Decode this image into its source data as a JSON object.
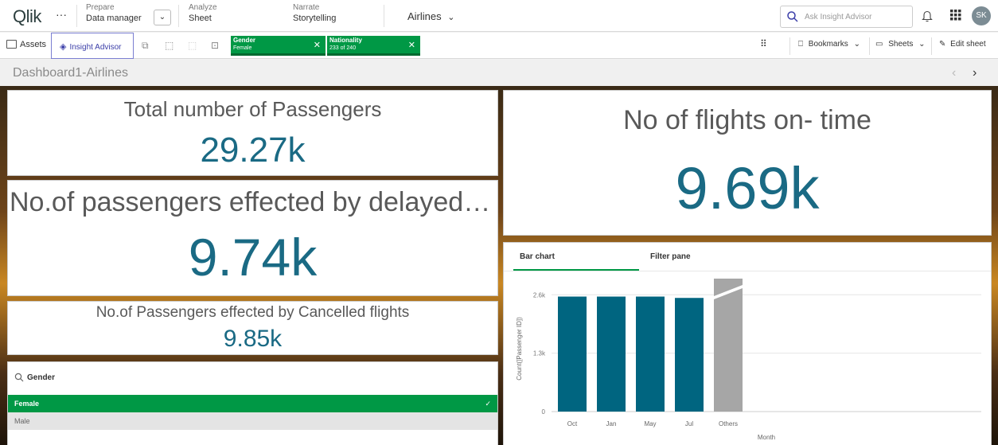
{
  "app": {
    "logo": "Qlik",
    "more": "···",
    "nav": [
      {
        "small": "Prepare",
        "big": "Data manager"
      },
      {
        "small": "Analyze",
        "big": "Sheet"
      },
      {
        "small": "Narrate",
        "big": "Storytelling"
      }
    ],
    "app_name": "Airlines",
    "search_placeholder": "Ask Insight Advisor",
    "avatar": "SK"
  },
  "toolbar": {
    "assets": "Assets",
    "insight_advisor": "Insight Advisor",
    "selections": [
      {
        "field": "Gender",
        "value": "Female"
      },
      {
        "field": "Nationality",
        "value": "233 of 240"
      }
    ],
    "bookmarks": "Bookmarks",
    "sheets": "Sheets",
    "edit_sheet": "Edit sheet"
  },
  "sheet": {
    "title": "Dashboard1-Airlines"
  },
  "kpis": {
    "total_passengers": {
      "title": "Total number of Passengers",
      "value": "29.27k"
    },
    "delayed": {
      "title": "No.of passengers effected by delayed fli...",
      "value": "9.74k"
    },
    "cancelled": {
      "title": "No.of Passengers effected by Cancelled flights",
      "value": "9.85k"
    },
    "on_time": {
      "title": "No of flights on- time",
      "value": "9.69k"
    }
  },
  "filter_pane": {
    "field": "Gender",
    "items": [
      {
        "label": "Female",
        "state": "selected"
      },
      {
        "label": "Male",
        "state": "alternative"
      }
    ]
  },
  "chart_tabs": [
    "Bar chart",
    "Filter pane"
  ],
  "chart_data": {
    "type": "bar",
    "categories": [
      "Oct",
      "Jan",
      "May",
      "Jul",
      "Others"
    ],
    "values": [
      2560,
      2560,
      2560,
      2530,
      2960
    ],
    "ylim": [
      0,
      2800
    ],
    "yticks": [
      {
        "value": 0,
        "label": "0"
      },
      {
        "value": 1300,
        "label": "1.3k"
      },
      {
        "value": 2600,
        "label": "2.6k"
      }
    ],
    "ylabel": "Count([Passenger ID])",
    "xlabel": "Month",
    "colors": {
      "bar": "#006580",
      "others": "#a6a6a6",
      "grid": "#e6e6e6"
    },
    "grid": true
  }
}
